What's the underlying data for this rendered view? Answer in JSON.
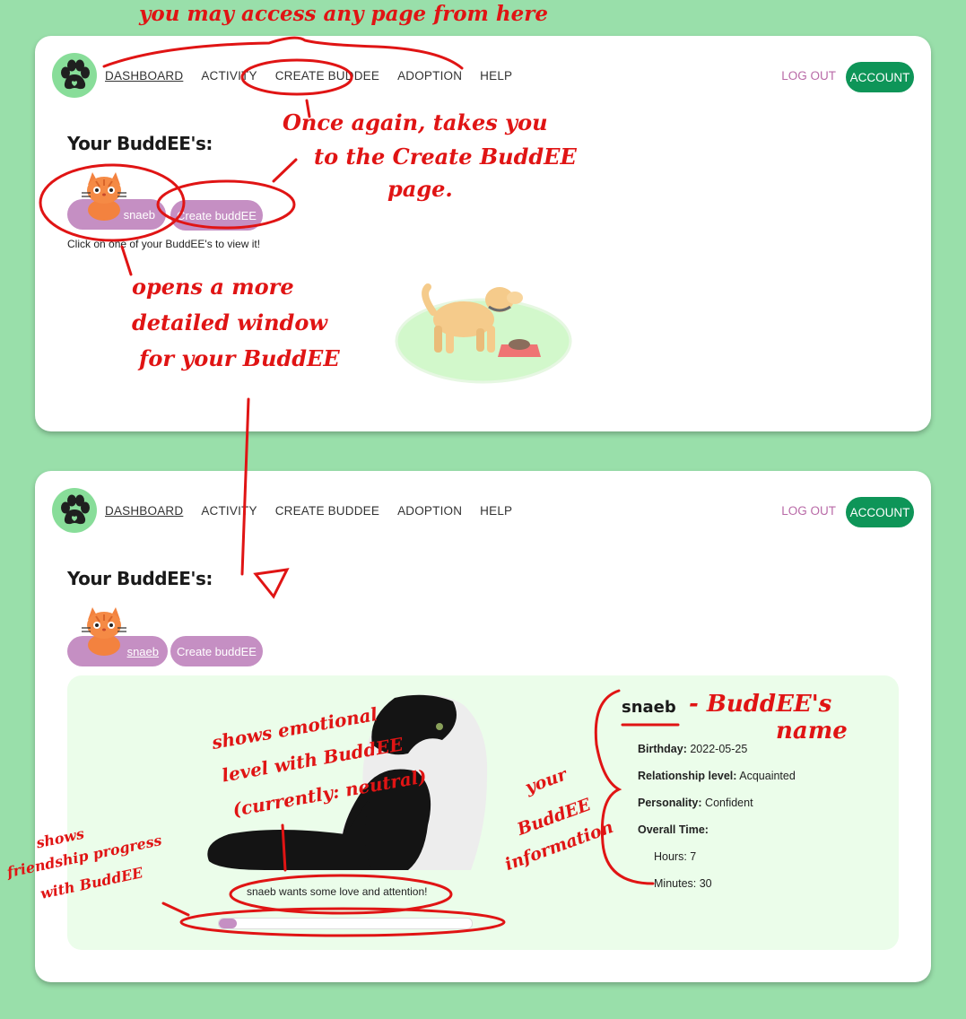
{
  "nav": {
    "items": [
      "DASHBOARD",
      "ACTIVITY",
      "CREATE BUDDEE",
      "ADOPTION",
      "HELP"
    ],
    "logout": "LOG OUT",
    "account": "ACCOUNT"
  },
  "page1": {
    "title": "Your BuddEE's:",
    "buddee_label": "snaeb",
    "create_label": "Create buddEE",
    "hint": "Click on one of your BuddEE's to view it!"
  },
  "page2": {
    "title": "Your BuddEE's:",
    "buddee_label": "snaeb",
    "create_label": "Create buddEE",
    "buddee": {
      "name": "snaeb",
      "birthday_label": "Birthday:",
      "birthday": "2022-05-25",
      "relationship_label": "Relationship level:",
      "relationship": "Acquainted",
      "personality_label": "Personality:",
      "personality": "Confident",
      "overall_label": "Overall Time:",
      "hours": "Hours: 7",
      "minutes": "Minutes: 30",
      "mood": "snaeb wants some love and attention!",
      "progress": 0.07
    }
  },
  "annotations": {
    "top": "you may access any page from here",
    "create_1": "Once again, takes you",
    "create_2": "to the Create BuddEE",
    "create_3": "page.",
    "opens_1": "opens a more",
    "opens_2": "detailed window",
    "opens_3": "for your BuddEE",
    "emotion_1": "shows emotional",
    "emotion_2": "level with BuddEE",
    "emotion_3": "(currently: neutral)",
    "friend_1": "shows",
    "friend_2": "friendship progress",
    "friend_3": "with BuddEE",
    "info_1": "your",
    "info_2": "BuddEE",
    "info_3": "information",
    "name_1": "- BuddEE's",
    "name_2": "name"
  },
  "colors": {
    "background": "#99dfaa",
    "accent_green": "#0e9558",
    "pill_purple": "#c58fc3",
    "annotation_red": "#e01414"
  }
}
